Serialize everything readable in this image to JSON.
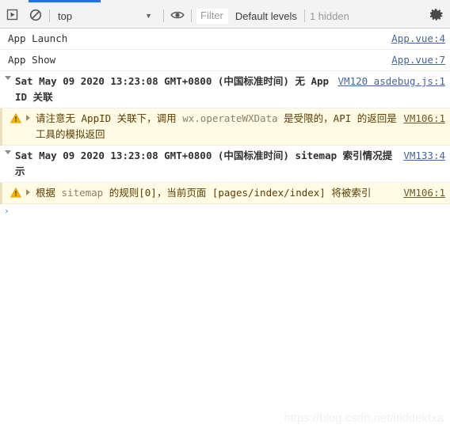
{
  "window": {
    "watermark": "https://blog.csdn.net/itkfdektxa"
  },
  "toolbar": {
    "execute_icon": "play-in-box-icon",
    "clear_icon": "clear-console-icon",
    "context_value": "top",
    "context_caret": "▼",
    "eye_icon": "eye-icon",
    "filter_placeholder": "Filter",
    "levels_label": "Default levels",
    "hidden_label": "1 hidden",
    "settings_icon": "gear-icon",
    "active_tab_color": "#1a73e8"
  },
  "console": {
    "messages": [
      {
        "type": "log",
        "text": "App Launch",
        "link": "App.vue:4"
      },
      {
        "type": "log",
        "text": "App Show",
        "link": "App.vue:7"
      },
      {
        "type": "group",
        "text": "Sat May 09 2020 13:23:08 GMT+0800 (中国标准时间) 无 AppID 关联",
        "link": "VM120 asdebug.js:1"
      },
      {
        "type": "warning",
        "text_before": "请注意无 AppID 关联下，调用 ",
        "code": "wx.operateWXData",
        "text_after": " 是受限的，API 的返回是工具的模拟返回",
        "link": "VM106:1"
      },
      {
        "type": "group",
        "text": "Sat May 09 2020 13:23:08 GMT+0800 (中国标准时间) sitemap 索引情况提示",
        "link": "VM133:4"
      },
      {
        "type": "warning",
        "text_before": "根据 ",
        "code": "sitemap",
        "text_after": " 的规则[0]，当前页面 [pages/index/index] 将被索引",
        "link": "VM106:1"
      }
    ],
    "prompt_symbol": "›",
    "prompt_value": ""
  }
}
